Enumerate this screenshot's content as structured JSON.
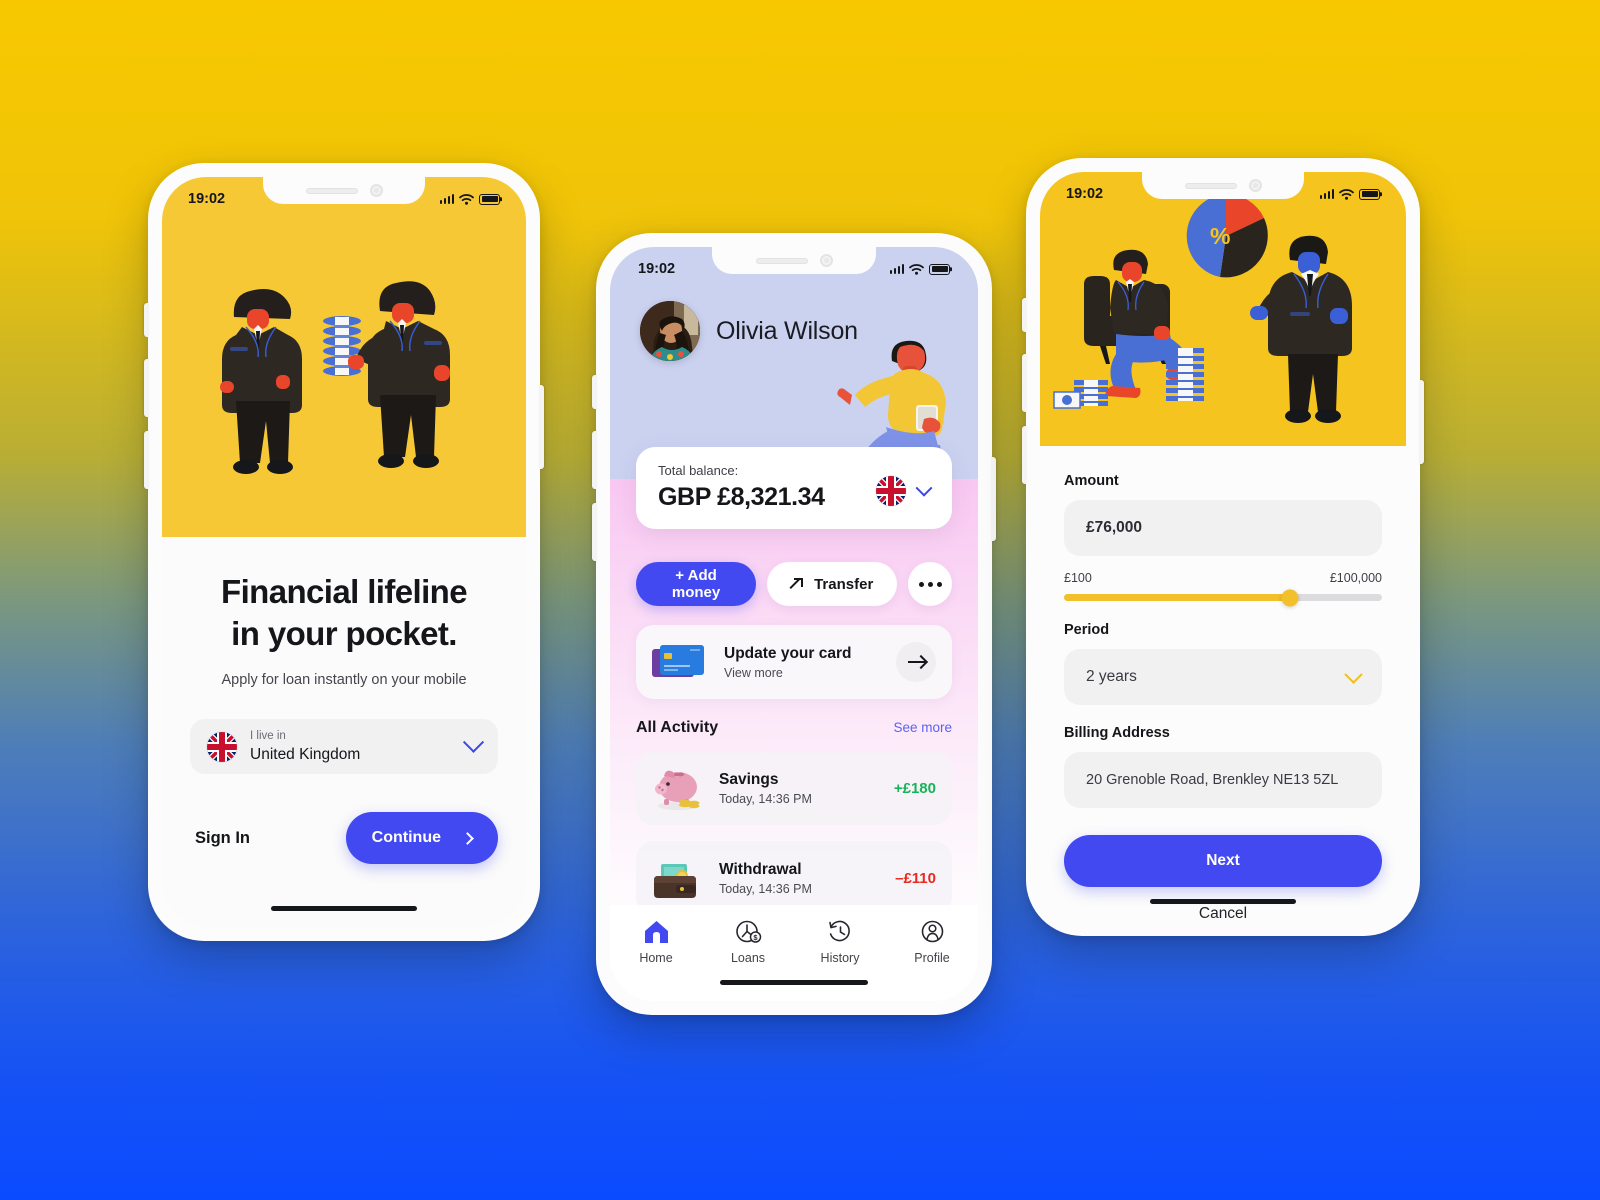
{
  "background": {
    "top_color": "#F7C800",
    "bottom_color": "#0A4BFF"
  },
  "brand": {
    "primary": "#4249F0",
    "yellow": "#F5C41F",
    "green": "#17B35B",
    "red": "#E8291F"
  },
  "phone1": {
    "status": {
      "time": "19:02",
      "signal_icon": "signal-icon",
      "wifi_icon": "wifi-icon",
      "battery_icon": "battery-icon"
    },
    "hero_illustration": "two-businessmen-exchanging-money-illustration",
    "title_line1": "Financial lifeline",
    "title_line2": "in your pocket.",
    "subtitle": "Apply for loan instantly on your mobile",
    "country_select": {
      "flag_icon": "uk-flag-icon",
      "label": "I live in",
      "value": "United Kingdom",
      "chevron_icon": "chevron-down-icon"
    },
    "sign_in_label": "Sign In",
    "continue_label": "Continue",
    "continue_arrow_icon": "chevron-right-icon"
  },
  "phone2": {
    "status": {
      "time": "19:02",
      "signal_icon": "signal-icon",
      "wifi_icon": "wifi-icon",
      "battery_icon": "battery-icon"
    },
    "user_name": "Olivia Wilson",
    "avatar_icon": "user-avatar-photo",
    "hero_illustration": "seated-man-with-coffee-illustration",
    "balance": {
      "label": "Total balance:",
      "amount": "GBP £8,321.34",
      "flag_icon": "uk-flag-icon",
      "chevron_icon": "chevron-down-icon"
    },
    "actions": {
      "add_money": "+ Add money",
      "transfer": "Transfer",
      "transfer_icon": "arrow-up-right-icon",
      "more_icon": "ellipsis-icon"
    },
    "card_promo": {
      "icon": "credit-card-icon",
      "title": "Update your card",
      "subtitle": "View more",
      "arrow_icon": "arrow-right-icon"
    },
    "activity": {
      "title": "All Activity",
      "see_more": "See more",
      "items": [
        {
          "icon": "piggy-bank-icon",
          "name": "Savings",
          "time": "Today, 14:36 PM",
          "amount": "+£180",
          "amount_color": "#17B35B"
        },
        {
          "icon": "wallet-icon",
          "name": "Withdrawal",
          "time": "Today, 14:36 PM",
          "amount": "–£110",
          "amount_color": "#E8291F"
        }
      ]
    },
    "tabs": [
      {
        "label": "Home",
        "icon": "home-icon",
        "active": true
      },
      {
        "label": "Loans",
        "icon": "clock-dollar-icon",
        "active": false
      },
      {
        "label": "History",
        "icon": "history-clock-icon",
        "active": false
      },
      {
        "label": "Profile",
        "icon": "profile-person-icon",
        "active": false
      }
    ]
  },
  "phone3": {
    "status": {
      "time": "19:02",
      "signal_icon": "signal-icon",
      "wifi_icon": "wifi-icon",
      "battery_icon": "battery-icon"
    },
    "hero_illustration": "seated-investor-with-pie-chart-and-advisor-illustration",
    "amount_label": "Amount",
    "amount_value": "£76,000",
    "slider": {
      "min_label": "£100",
      "max_label": "£100,000",
      "fill_percent": 71
    },
    "period_label": "Period",
    "period_value": "2 years",
    "period_chevron_icon": "chevron-down-icon",
    "billing_label": "Billing Address",
    "billing_value": "20 Grenoble Road, Brenkley NE13 5ZL",
    "next_label": "Next",
    "cancel_label": "Cancel"
  }
}
